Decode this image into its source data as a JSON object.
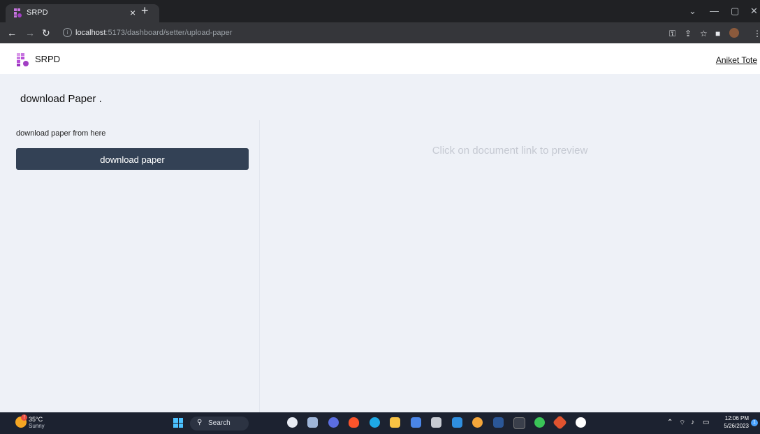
{
  "browser": {
    "tab_title": "SRPD",
    "tab_close": "×",
    "new_tab": "+",
    "url_host": "localhost",
    "url_rest": ":5173/dashboard/setter/upload-paper"
  },
  "app": {
    "brand": "SRPD",
    "user_name": "Aniket Tote"
  },
  "page": {
    "title": "download Paper .",
    "subtitle": "download paper from here",
    "download_button": "download paper",
    "preview_placeholder": "Click on document link to preview"
  },
  "taskbar": {
    "temperature": "35°C",
    "weather": "Sunny",
    "search_label": "Search",
    "time": "12:06 PM",
    "date": "5/26/2023",
    "notification_count": "1"
  },
  "colors": {
    "accent": "#334155",
    "page_bg": "#eef1f7",
    "logo": "#b84fd8"
  }
}
